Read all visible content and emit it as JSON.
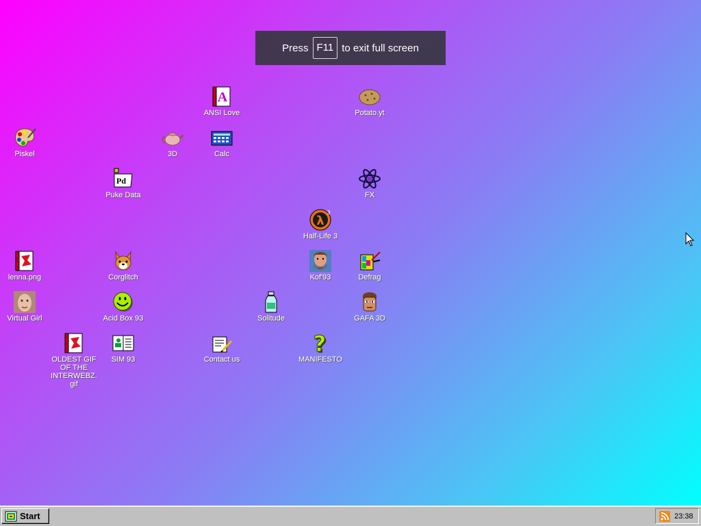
{
  "fullscreen_hint": {
    "prefix": "Press",
    "key": "F11",
    "suffix": "to exit full screen"
  },
  "desktop_icons": {
    "ansi_love": "ANSI Love",
    "potato": "Potato.yt",
    "piskel": "Piskel",
    "three_d": "3D",
    "calc": "Calc",
    "puke_data": "Puke Data",
    "fx": "FX",
    "half_life": "Half-Life 3",
    "lenna": "lenna.png",
    "corglitch": "Corglitch",
    "kof": "Kof'93",
    "defrag": "Defrag",
    "virtual_girl": "Virtual Girl",
    "acid_box": "Acid Box 93",
    "solitude": "Solitude",
    "gafa": "GAFA 3D",
    "oldest_gif": "OLDEST GIF OF THE INTERWEBZ.gif",
    "sim": "SIM 93",
    "contact": "Contact us",
    "manifesto": "MANIFESTO"
  },
  "icon_names": [
    "ansi-love-icon",
    "potato-icon",
    "piskel-palette-icon",
    "teapot-icon",
    "calculator-icon",
    "puke-data-icon",
    "atom-icon",
    "half-life-icon",
    "image-file-icon",
    "corgi-icon",
    "fighter-icon",
    "defrag-icon",
    "face-icon",
    "smiley-icon",
    "bottle-icon",
    "soldier-icon",
    "gif-file-icon",
    "sim-card-icon",
    "contact-letter-icon",
    "question-mark-icon"
  ],
  "taskbar": {
    "start_label": "Start",
    "clock": "23:38"
  },
  "colors": {
    "gradient_start": "#ff00ff",
    "gradient_end": "#00ffff",
    "taskbar": "#c0c0c0"
  }
}
